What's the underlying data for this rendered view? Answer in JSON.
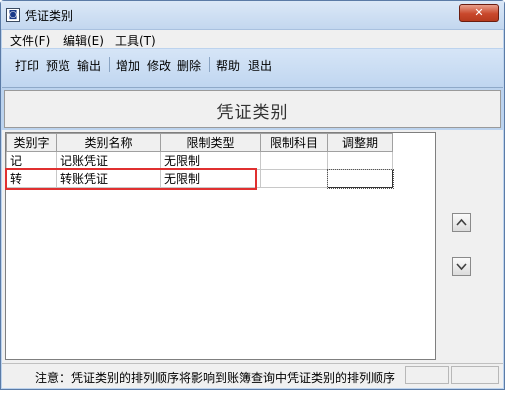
{
  "window": {
    "title": "凭证类别",
    "close_label": "✕",
    "app_icon": "◙"
  },
  "menu": [
    {
      "label": "文件(F)"
    },
    {
      "label": "编辑(E)"
    },
    {
      "label": "工具(T)"
    }
  ],
  "toolbar": {
    "print": "打印",
    "preview": "预览",
    "export": "输出",
    "add": "增加",
    "edit": "修改",
    "delete": "删除",
    "help": "帮助",
    "exit": "退出"
  },
  "header": {
    "title": "凭证类别"
  },
  "table": {
    "columns": [
      "类别字",
      "类别名称",
      "限制类型",
      "限制科目",
      "调整期"
    ],
    "rows": [
      [
        "记",
        "记账凭证",
        "无限制",
        "",
        ""
      ],
      [
        "转",
        "转账凭证",
        "无限制",
        "",
        ""
      ]
    ]
  },
  "status": {
    "note": "注意：凭证类别的排列顺序将影响到账簿查询中凭证类别的排列顺序"
  },
  "colors": {
    "highlight": "#e03030",
    "titlebar": "#c3d7ef",
    "close": "#c9482c"
  },
  "icons": {
    "up": "chevron-up-icon",
    "down": "chevron-down-icon"
  }
}
